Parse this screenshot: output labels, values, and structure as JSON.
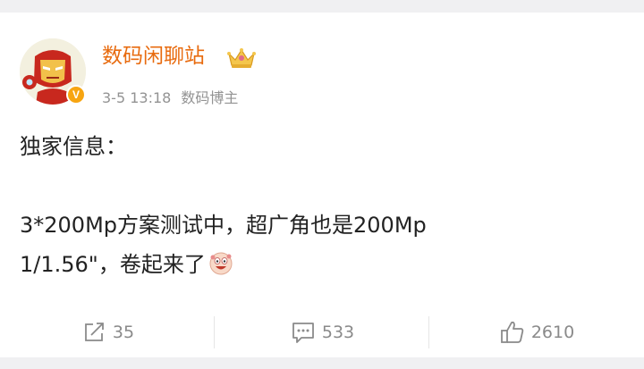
{
  "user": {
    "name": "数码闲聊站",
    "verified_badge": "V",
    "crown_icon": "crown-icon",
    "avatar_icon": "ironman-avatar"
  },
  "meta": {
    "time": "3-5 13:18",
    "tag": "数码博主"
  },
  "post": {
    "line1": "独家信息：",
    "line2": "3*200Mp方案测试中，超广角也是200Mp",
    "line3": "1/1.56\"，卷起来了",
    "emoji": "laughing-emoji"
  },
  "actions": {
    "repost_count": "35",
    "comment_count": "533",
    "like_count": "2610"
  },
  "colors": {
    "username": "#e86b0f",
    "badge": "#f7a511",
    "muted": "#939393"
  }
}
